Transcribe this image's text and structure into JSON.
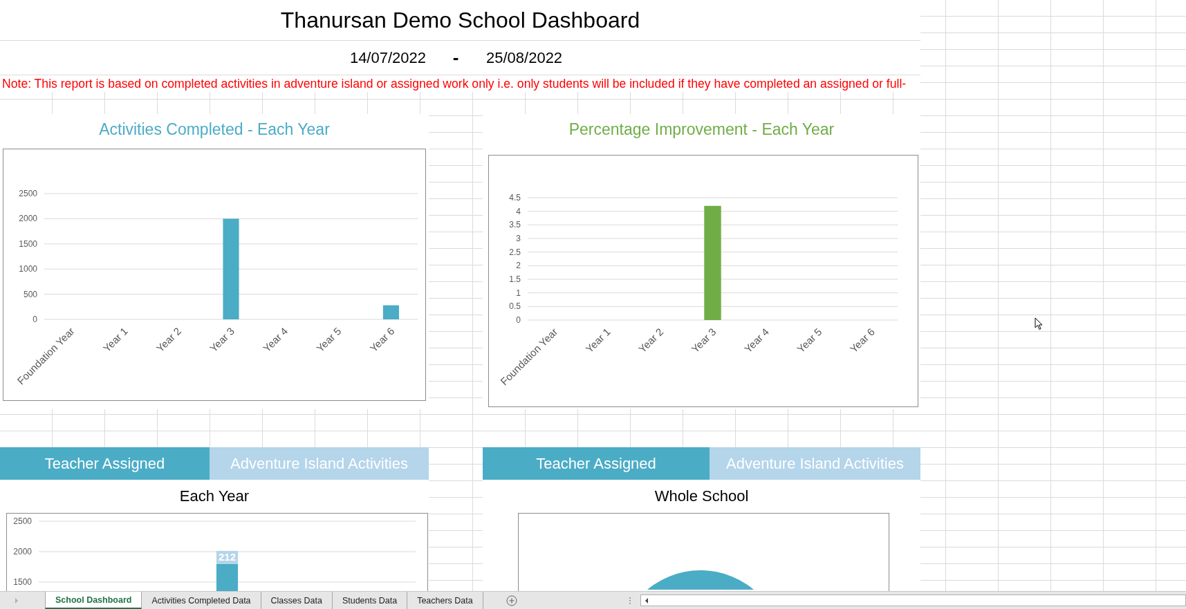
{
  "title": "Thanursan Demo School Dashboard",
  "date_range": {
    "start": "14/07/2022",
    "separator": "-",
    "end": "25/08/2022"
  },
  "note": "Note: This report is based on completed activities in adventure island or assigned work only i.e. only students will be included if they have completed an assigned or full-",
  "charts": [
    {
      "title": "Activities Completed - Each Year",
      "color": "#4bacc6",
      "chart_data": {
        "type": "bar",
        "grid": true,
        "categories": [
          "Foundation Year",
          "Year 1",
          "Year 2",
          "Year 3",
          "Year 4",
          "Year 5",
          "Year 6"
        ],
        "ylim": [
          0,
          2500
        ],
        "yticks": [
          0,
          500,
          1000,
          1500,
          2000,
          2500
        ],
        "series": [
          {
            "color": "#4bacc6",
            "values": [
              0,
              0,
              0,
              2000,
              0,
              0,
              280
            ]
          }
        ]
      }
    },
    {
      "title": "Percentage Improvement - Each Year",
      "color": "#70ad47",
      "chart_data": {
        "type": "bar",
        "grid": true,
        "categories": [
          "Foundation Year",
          "Year 1",
          "Year 2",
          "Year 3",
          "Year 4",
          "Year 5",
          "Year 6"
        ],
        "ylim": [
          0,
          4.5
        ],
        "yticks": [
          0,
          0.5,
          1,
          1.5,
          2,
          2.5,
          3,
          3.5,
          4,
          4.5
        ],
        "series": [
          {
            "color": "#70ad47",
            "values": [
              0,
              0,
              0,
              4.2,
              0,
              0,
              0
            ]
          }
        ]
      }
    }
  ],
  "panels": [
    {
      "tabs": [
        {
          "label": "Teacher Assigned",
          "selected": true
        },
        {
          "label": "Adventure Island Activities",
          "selected": false
        }
      ],
      "heading": "Each Year",
      "chart_data": {
        "type": "bar",
        "grid": true,
        "stacked": true,
        "ylim": [
          0,
          2500
        ],
        "yticks": [
          1500,
          2000,
          2500
        ],
        "series": [
          {
            "color": "#4bacc6",
            "values": [
              null,
              null,
              null,
              1800,
              null,
              null,
              null
            ]
          },
          {
            "color": "#b4d5ea",
            "values": [
              null,
              null,
              null,
              212,
              null,
              null,
              null
            ],
            "data_labels": true
          }
        ]
      }
    },
    {
      "tabs": [
        {
          "label": "Teacher Assigned",
          "selected": true
        },
        {
          "label": "Adventure Island Activities",
          "selected": false
        }
      ],
      "heading": "Whole School"
    }
  ],
  "sheet_tabs": [
    {
      "label": "School Dashboard",
      "selected": true
    },
    {
      "label": "Activities Completed Data",
      "selected": false
    },
    {
      "label": "Classes Data",
      "selected": false
    },
    {
      "label": "Students Data",
      "selected": false
    },
    {
      "label": "Teachers Data",
      "selected": false
    }
  ]
}
